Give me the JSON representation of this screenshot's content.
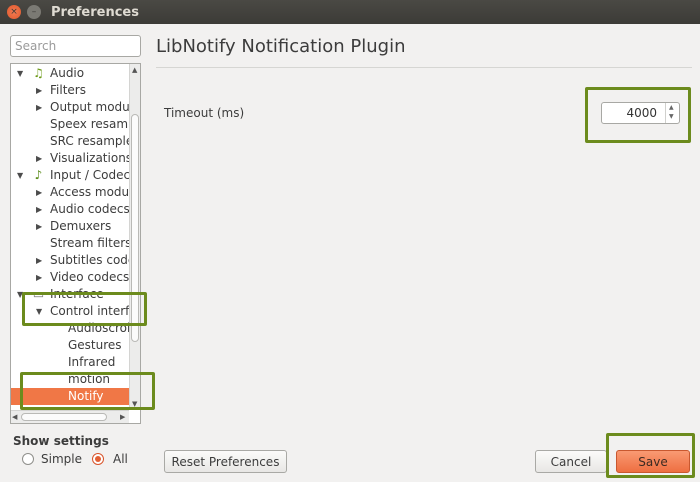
{
  "window": {
    "title": "Preferences",
    "close_glyph": "×",
    "minimize_glyph": "–"
  },
  "search": {
    "placeholder": "Search"
  },
  "tree": {
    "items": [
      {
        "label": "Audio",
        "arrow": "▼",
        "icon": "music-note-icon"
      },
      {
        "label": "Filters",
        "arrow": "▶"
      },
      {
        "label": "Output modu",
        "arrow": "▶"
      },
      {
        "label": "Speex resamp",
        "arrow": ""
      },
      {
        "label": "SRC resample",
        "arrow": ""
      },
      {
        "label": "Visualizations",
        "arrow": "▶"
      },
      {
        "label": "Input / Codec",
        "arrow": "▼",
        "icon": "input-codec-icon"
      },
      {
        "label": "Access modul",
        "arrow": "▶"
      },
      {
        "label": "Audio codecs",
        "arrow": "▶"
      },
      {
        "label": "Demuxers",
        "arrow": "▶"
      },
      {
        "label": "Stream filters",
        "arrow": ""
      },
      {
        "label": "Subtitles code",
        "arrow": "▶"
      },
      {
        "label": "Video codecs",
        "arrow": "▶"
      },
      {
        "label": "Interface",
        "arrow": "▼",
        "icon": "interface-icon"
      },
      {
        "label": "Control interf",
        "arrow": "▼"
      },
      {
        "label": "Audioscrob",
        "arrow": ""
      },
      {
        "label": "Gestures",
        "arrow": ""
      },
      {
        "label": "Infrared",
        "arrow": ""
      },
      {
        "label": "motion",
        "arrow": ""
      },
      {
        "label": "Notify",
        "arrow": ""
      }
    ]
  },
  "show_settings": {
    "label": "Show settings",
    "options": [
      {
        "label": "Simple",
        "checked": false
      },
      {
        "label": "All",
        "checked": true
      }
    ]
  },
  "panel": {
    "title": "LibNotify Notification Plugin",
    "timeout_label": "Timeout (ms)",
    "timeout_value": "4000"
  },
  "buttons": {
    "reset": "Reset Preferences",
    "cancel": "Cancel",
    "save": "Save"
  },
  "colors": {
    "accent": "#f07746",
    "highlight": "#6c8b1d"
  }
}
